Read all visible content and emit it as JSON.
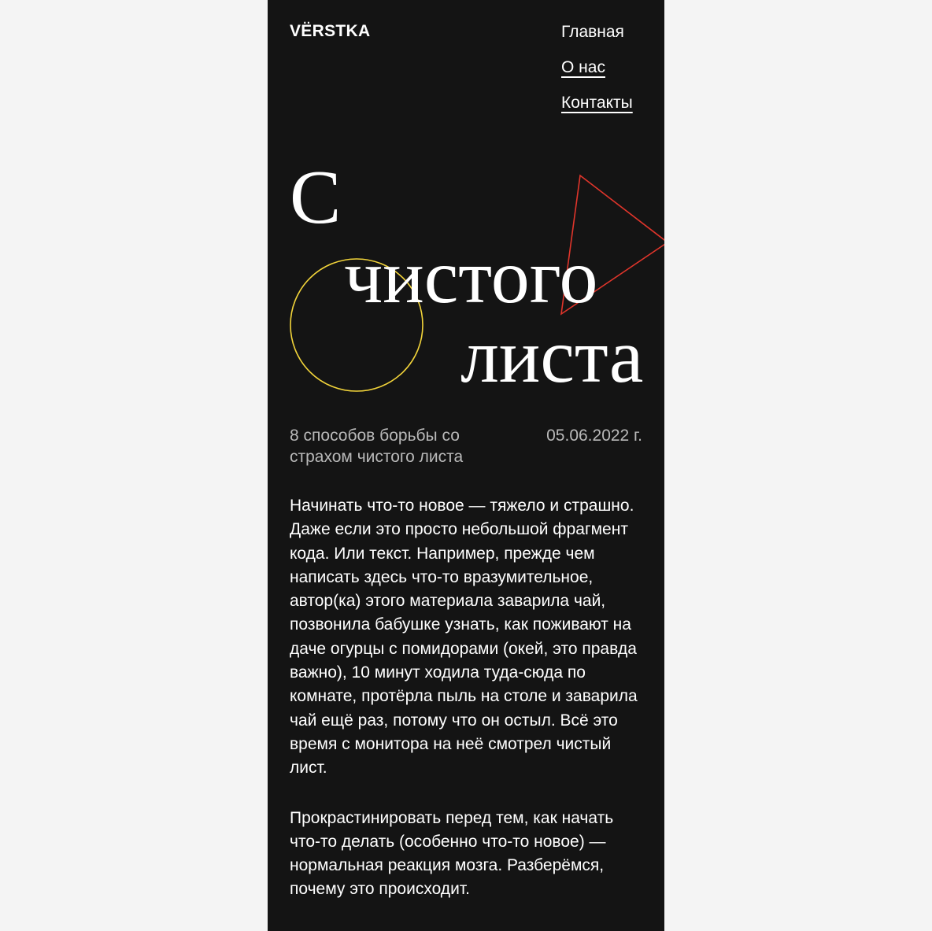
{
  "header": {
    "logo": "VЁRSTKA",
    "nav": [
      {
        "label": "Главная"
      },
      {
        "label": "О нас"
      },
      {
        "label": "Контакты"
      }
    ]
  },
  "hero": {
    "title_lines": [
      "С",
      "чистого",
      "листа"
    ],
    "decor": {
      "circle_color": "#f2d43a",
      "triangle_color": "#e0352b"
    }
  },
  "meta": {
    "subtitle": "8 способов борьбы со страхом чистого листа",
    "date": "05.06.2022 г."
  },
  "content": {
    "paragraphs": [
      "Начинать что-то новое — тяжело и страшно. Даже если это просто небольшой фрагмент кода. Или текст. Например, прежде чем написать здесь что-то вразумительное, автор(ка) этого материала заварила чай, позвонила бабушке узнать, как поживают на даче огурцы с помидорами (окей, это правда важно), 10 минут ходила туда-сюда по комнате, протёрла пыль на столе и заварила чай ещё раз, потому что он остыл. Всё это время с монитора на неё смотрел чистый лист.",
      "Прокрастинировать перед тем, как начать что-то делать (особенно что-то новое) — нормальная реакция мозга. Разберёмся, почему это происходит."
    ]
  },
  "colors": {
    "page_background": "#141414",
    "outer_background": "#f4f4f4",
    "text": "#ffffff",
    "muted_text": "#b9b9b9"
  }
}
